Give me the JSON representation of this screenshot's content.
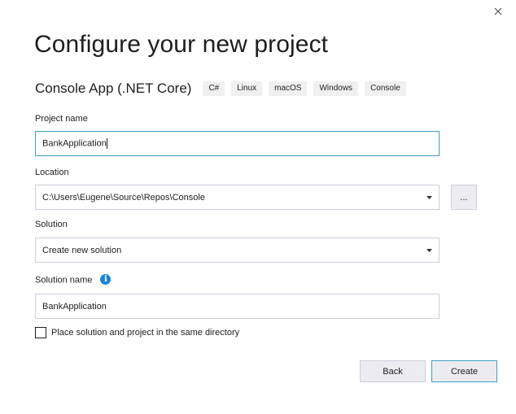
{
  "dialog": {
    "title": "Configure your new project",
    "close_icon": "close-icon"
  },
  "template": {
    "name": "Console App (.NET Core)",
    "tags": [
      "C#",
      "Linux",
      "macOS",
      "Windows",
      "Console"
    ]
  },
  "project_name": {
    "label": "Project name",
    "value": "BankApplication"
  },
  "location": {
    "label": "Location",
    "value": "C:\\Users\\Eugene\\Source\\Repos\\Console",
    "browse_label": "..."
  },
  "solution": {
    "label": "Solution",
    "value": "Create new solution"
  },
  "solution_name": {
    "label": "Solution name",
    "value": "BankApplication",
    "info_glyph": "i"
  },
  "same_directory": {
    "label": "Place solution and project in the same directory",
    "checked": false
  },
  "buttons": {
    "back": "Back",
    "create": "Create"
  },
  "colors": {
    "accent": "#3e9fc3",
    "info": "#1a85d8",
    "tag_bg": "#f0f0f0",
    "button_bg": "#ececf0"
  }
}
